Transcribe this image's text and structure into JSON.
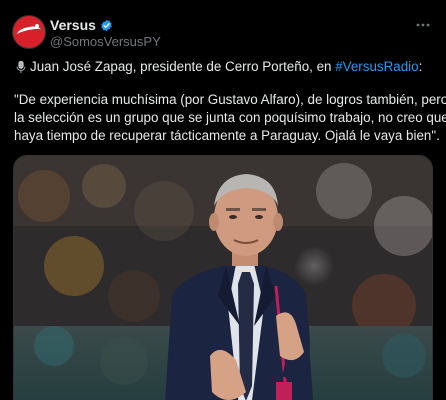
{
  "tweet": {
    "author": {
      "display_name": "Versus",
      "handle": "@SomosVersusPY",
      "verified": true
    },
    "intro": {
      "icon": "microphone-icon",
      "text": "Juan José Zapag, presidente de Cerro Porteño, en ",
      "hashtag": "#VersusRadio",
      "suffix": ":"
    },
    "quote_lines": [
      "\"De experiencia muchísima (por Gustavo Alfaro), de logros también, pero",
      "la selección es un grupo que se junta con poquísimo trabajo, no creo que",
      "haya tiempo de recuperar tácticamente a Paraguay. Ojalá le vaya bien\"."
    ],
    "media": {
      "description_icon": "photo-coach-clapping"
    },
    "colors": {
      "background": "#000000",
      "text": "#e7e9ea",
      "muted": "#71767b",
      "link": "#1d9bf0",
      "brand": "#d8202a"
    }
  }
}
